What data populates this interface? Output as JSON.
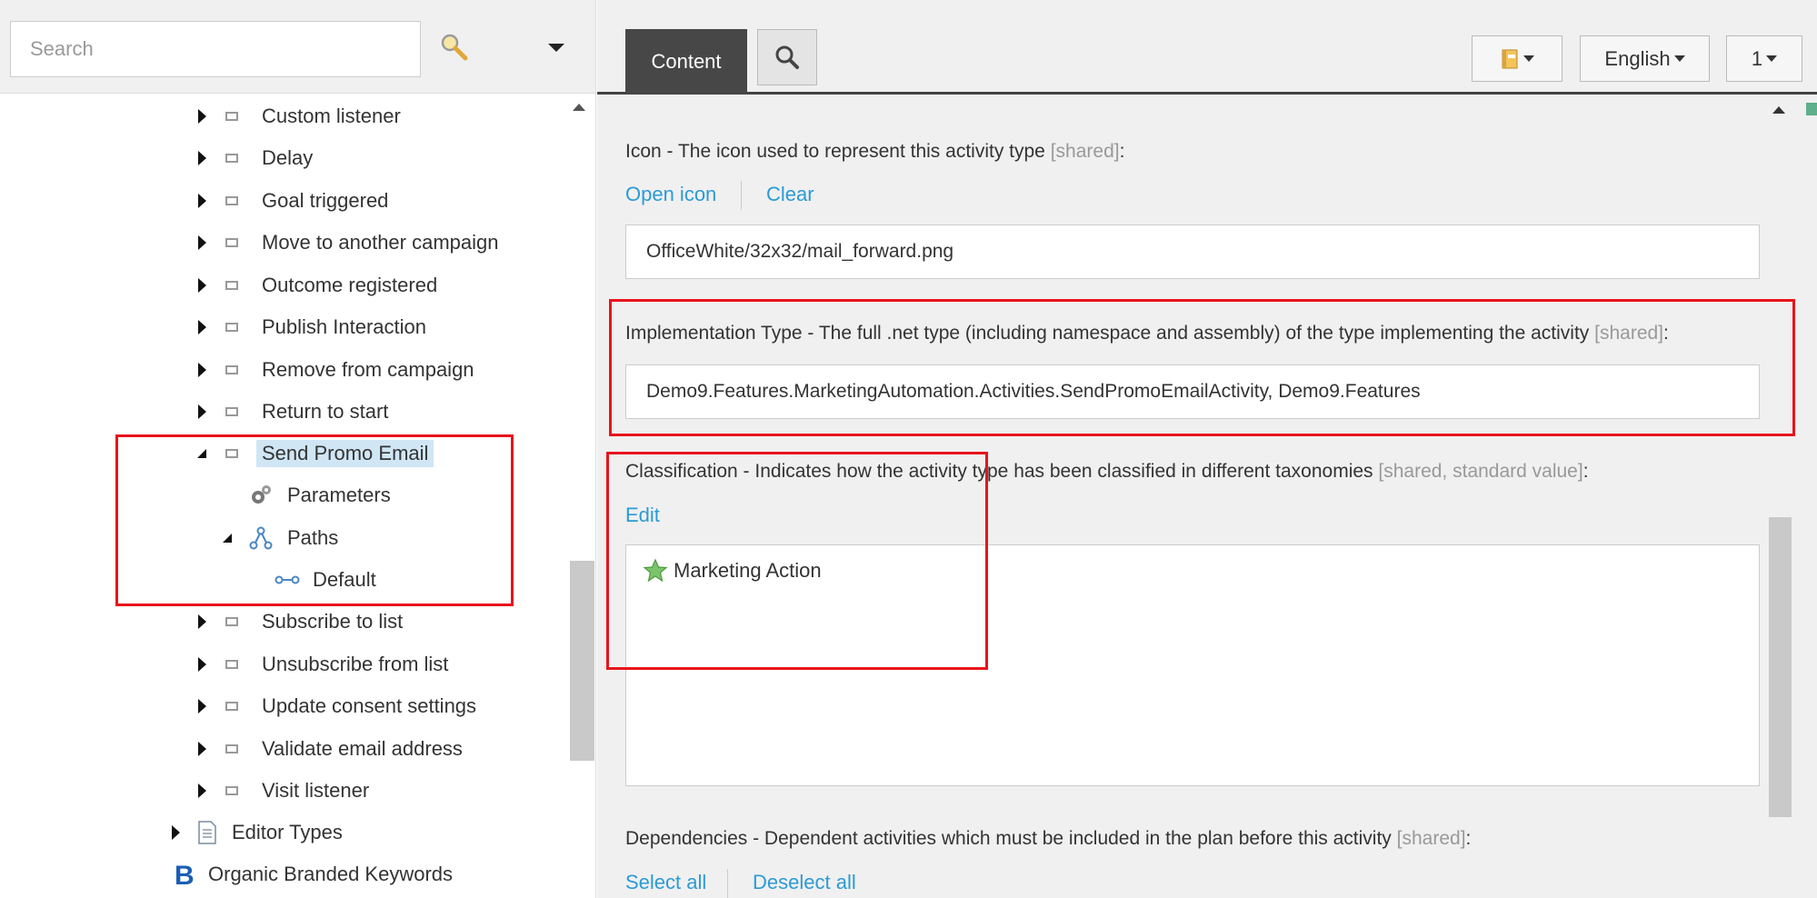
{
  "search": {
    "placeholder": "Search"
  },
  "tree": {
    "items": [
      {
        "label": "Custom listener"
      },
      {
        "label": "Delay"
      },
      {
        "label": "Goal triggered"
      },
      {
        "label": "Move to another campaign"
      },
      {
        "label": "Outcome registered"
      },
      {
        "label": "Publish Interaction"
      },
      {
        "label": "Remove from campaign"
      },
      {
        "label": "Return to start"
      },
      {
        "label": "Send Promo Email"
      },
      {
        "label": "Parameters"
      },
      {
        "label": "Paths"
      },
      {
        "label": "Default"
      },
      {
        "label": "Subscribe to list"
      },
      {
        "label": "Unsubscribe from list"
      },
      {
        "label": "Update consent settings"
      },
      {
        "label": "Validate email address"
      },
      {
        "label": "Visit listener"
      },
      {
        "label": "Editor Types"
      },
      {
        "label": "Organic Branded Keywords"
      }
    ]
  },
  "toolbar": {
    "content_tab": "Content",
    "language": "English",
    "version": "1"
  },
  "fields": {
    "icon": {
      "label": "Icon - The icon used to represent this activity type",
      "meta": "[shared]",
      "suffix": ":",
      "open_link": "Open icon",
      "clear_link": "Clear",
      "value": "OfficeWhite/32x32/mail_forward.png"
    },
    "implementation": {
      "label": "Implementation Type - The full .net type (including namespace and assembly) of the type implementing the activity",
      "meta": "[shared]",
      "suffix": ":",
      "value": "Demo9.Features.MarketingAutomation.Activities.SendPromoEmailActivity, Demo9.Features"
    },
    "classification": {
      "label": "Classification - Indicates how the activity type has been classified in different taxonomies",
      "meta": "[shared, standard value]",
      "suffix": ":",
      "edit_link": "Edit",
      "item": "Marketing Action"
    },
    "dependencies": {
      "label": "Dependencies - Dependent activities which must be included in the plan before this activity",
      "meta": "[shared]",
      "suffix": ":",
      "select_all": "Select all",
      "deselect_all": "Deselect all"
    }
  },
  "colors": {
    "link": "#2b9bd6",
    "highlight_box": "#e8141c",
    "tab_active": "#474747",
    "selected_row": "#d0e6f5"
  }
}
